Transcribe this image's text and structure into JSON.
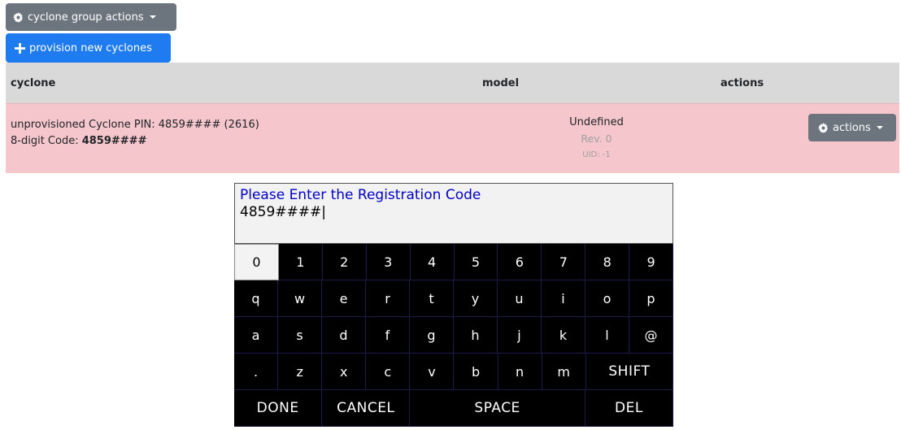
{
  "toolbar": {
    "group_actions_label": "cyclone group actions",
    "provision_label": "provision new cyclones"
  },
  "table": {
    "headers": [
      "cyclone",
      "model",
      "actions"
    ],
    "row": {
      "pin_text": "unprovisioned Cyclone PIN: 4859#### (2616)",
      "code_label": "8-digit Code: ",
      "code_value": "4859####",
      "model": "Undefined",
      "rev": "Rev. 0",
      "uid": "UID: -1",
      "actions_label": "actions"
    },
    "row_status_color": "#f5c6cb"
  },
  "keyboard": {
    "prompt": "Please Enter the Registration Code",
    "entry": "4859####|",
    "rows": [
      [
        "0",
        "1",
        "2",
        "3",
        "4",
        "5",
        "6",
        "7",
        "8",
        "9"
      ],
      [
        "q",
        "w",
        "e",
        "r",
        "t",
        "y",
        "u",
        "i",
        "o",
        "p"
      ],
      [
        "a",
        "s",
        "d",
        "f",
        "g",
        "h",
        "j",
        "k",
        "l",
        "@"
      ],
      [
        ".",
        "z",
        "x",
        "c",
        "v",
        "b",
        "n",
        "m",
        "SHIFT"
      ],
      [
        "DONE",
        "CANCEL",
        "SPACE",
        "DEL"
      ]
    ],
    "selected_key": "0"
  },
  "colors": {
    "primary_button": "#1f7cf0",
    "secondary_button": "#6c757d",
    "prompt_text": "#0000c8"
  }
}
